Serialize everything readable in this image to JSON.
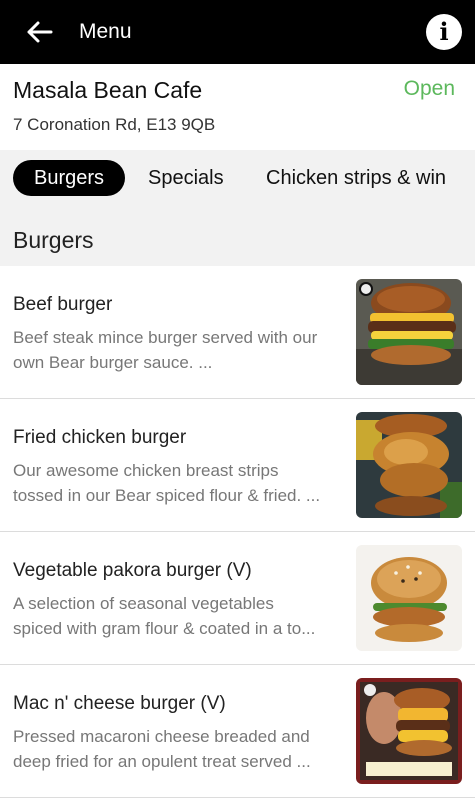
{
  "header": {
    "title": "Menu",
    "back_icon": "arrow-left-icon",
    "info_icon": "info-icon",
    "info_glyph": "i"
  },
  "cafe": {
    "name": "Masala Bean Cafe",
    "status": "Open",
    "status_color": "#5cb85c",
    "address": "7 Coronation Rd, E13 9QB"
  },
  "tabs": [
    {
      "label": "Burgers",
      "active": true
    },
    {
      "label": "Specials",
      "active": false
    },
    {
      "label": "Chicken strips & win",
      "active": false
    }
  ],
  "section": {
    "title": "Burgers"
  },
  "items": [
    {
      "name": "Beef burger",
      "description_line1": "Beef steak mince burger served with our",
      "description_line2": "own Bear burger sauce.  ..."
    },
    {
      "name": "Fried chicken burger",
      "description_line1": "Our awesome chicken breast strips",
      "description_line2": "tossed in our Bear spiced flour & fried. ..."
    },
    {
      "name": "Vegetable pakora burger (V)",
      "description_line1": "A selection of seasonal vegetables",
      "description_line2": "spiced with gram flour & coated in a to..."
    },
    {
      "name": "Mac n' cheese burger (V)",
      "description_line1": "Pressed macaroni cheese breaded and",
      "description_line2": "deep fried for an opulent treat served ..."
    }
  ],
  "colors": {
    "topbar": "#000000",
    "active_tab": "#000000",
    "section_bg": "#f2f2f2",
    "description_text": "#777777"
  }
}
